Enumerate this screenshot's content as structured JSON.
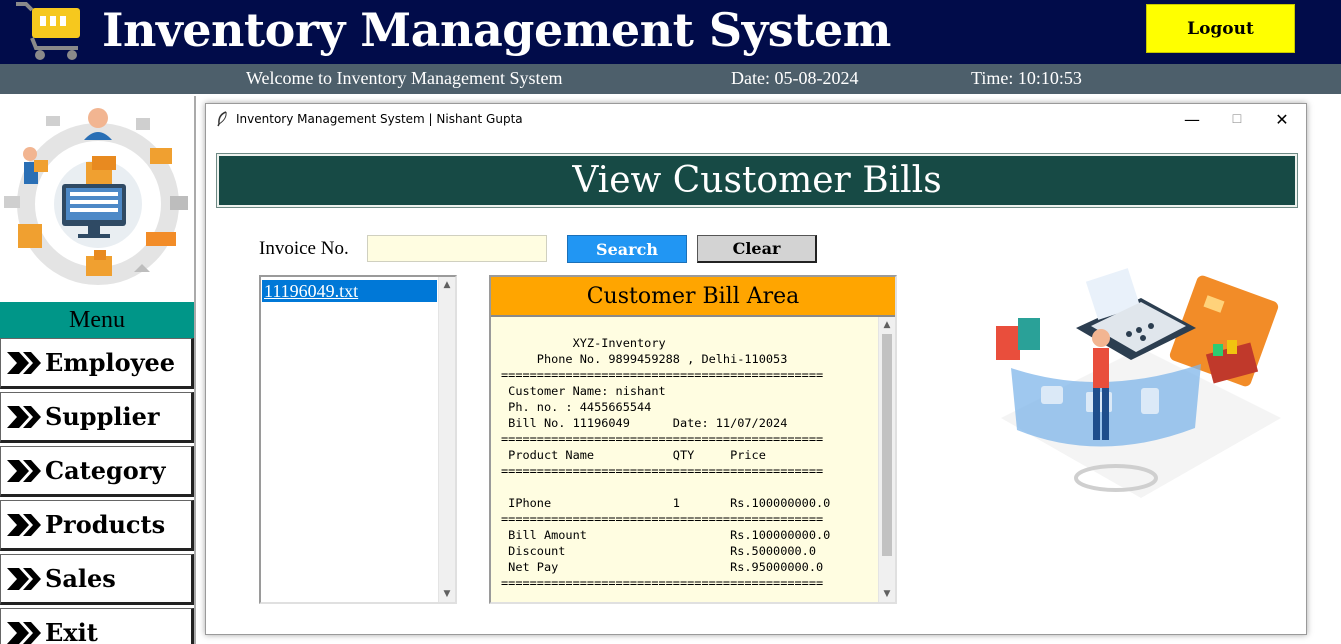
{
  "app": {
    "title": "Inventory Management System",
    "logout_label": "Logout"
  },
  "status": {
    "welcome": "Welcome to Inventory Management System",
    "date": "Date: 05-08-2024",
    "time": "Time: 10:10:53"
  },
  "menu": {
    "title": "Menu",
    "items": [
      {
        "label": "Employee"
      },
      {
        "label": "Supplier"
      },
      {
        "label": "Category"
      },
      {
        "label": "Products"
      },
      {
        "label": "Sales"
      },
      {
        "label": "Exit"
      }
    ]
  },
  "window": {
    "title": "Inventory Management System | Nishant Gupta",
    "controls": {
      "minimize": "—",
      "maximize": "☐",
      "close": "✕"
    }
  },
  "page": {
    "banner": "View Customer Bills",
    "invoice_label": "Invoice No.",
    "invoice_value": "",
    "search_label": "Search",
    "clear_label": "Clear"
  },
  "bills": {
    "files": [
      "11196049.txt"
    ],
    "selected_index": 0
  },
  "bill_area": {
    "title": "Customer Bill Area",
    "content": "          XYZ-Inventory\n     Phone No. 9899459288 , Delhi-110053\n=============================================\n Customer Name: nishant\n Ph. no. : 4455665544\n Bill No. 11196049      Date: 11/07/2024\n=============================================\n Product Name           QTY     Price\n=============================================\n\n IPhone                 1       Rs.100000000.0\n=============================================\n Bill Amount                    Rs.100000000.0\n Discount                       Rs.5000000.0\n Net Pay                        Rs.95000000.0\n============================================="
  },
  "colors": {
    "titlebar_bg": "#010c4a",
    "statusbar_bg": "#4d5f6b",
    "logout_bg": "#ffff00",
    "menu_head_bg": "#009688",
    "banner_bg": "#174a45",
    "search_bg": "#2196f3",
    "clear_bg": "#d3d3d3",
    "bill_head_bg": "#ffa500",
    "bill_area_bg": "#fffde1",
    "list_selected_bg": "#0078d7"
  },
  "icons": {
    "app_logo": "shopping-cart-icon",
    "menu_bullet": "double-chevron-right-icon",
    "window_icon": "feather-icon",
    "hero": "inventory-illustration",
    "side_illustration": "pos-payment-illustration"
  }
}
